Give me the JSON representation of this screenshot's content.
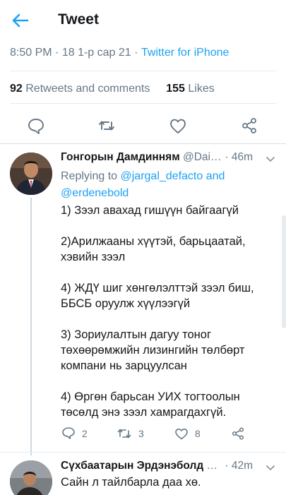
{
  "header": {
    "title": "Tweet"
  },
  "meta": {
    "time": "8:50 PM",
    "date": "18 1-р сар 21",
    "separator": "·",
    "source": "Twitter for iPhone"
  },
  "stats": {
    "retweets_count": "92",
    "retweets_label": "Retweets and comments",
    "likes_count": "155",
    "likes_label": "Likes"
  },
  "icons": {
    "back": "arrow-left-icon",
    "reply": "comment-icon",
    "retweet": "retweet-icon",
    "like": "heart-icon",
    "share": "share-icon",
    "chevron": "chevron-down-icon"
  },
  "colors": {
    "accent": "#1da1f2",
    "muted": "#657786",
    "text": "#14171a"
  },
  "reply": {
    "name": "Гонгорын Дамдинням",
    "handle": "@Dai…",
    "time": "46m",
    "replying_prefix": "Replying to",
    "mention1": "@jargal_defacto",
    "and": "and",
    "mention2": "@erdenebold",
    "paragraphs": [
      "1) Зээл авахад гишүүн байгаагүй",
      "2)Арилжааны хүүтэй, барьцаатай,\nхэвийн зээл",
      "4) ЖДҮ шиг хөнгөлэлттэй зээл биш,\nББСБ оруулж хүүлээгүй",
      "3) Зориулалтын дагуу тоног\nтөхөөрөмжийн лизингийн  төлбөрт\nкомпани нь зарцуулсан",
      "4) Өргөн барьсан УИХ тогтоолын\nтөсөлд энэ зээл хамрагдахгүй."
    ],
    "reply_count": "2",
    "retweet_count": "3",
    "like_count": "8"
  },
  "reply2": {
    "name": "Сүхбаатарын Эрдэнэболд",
    "handle": "…",
    "time": "42m",
    "text": "Сайн л тайлбарла даа хө."
  }
}
